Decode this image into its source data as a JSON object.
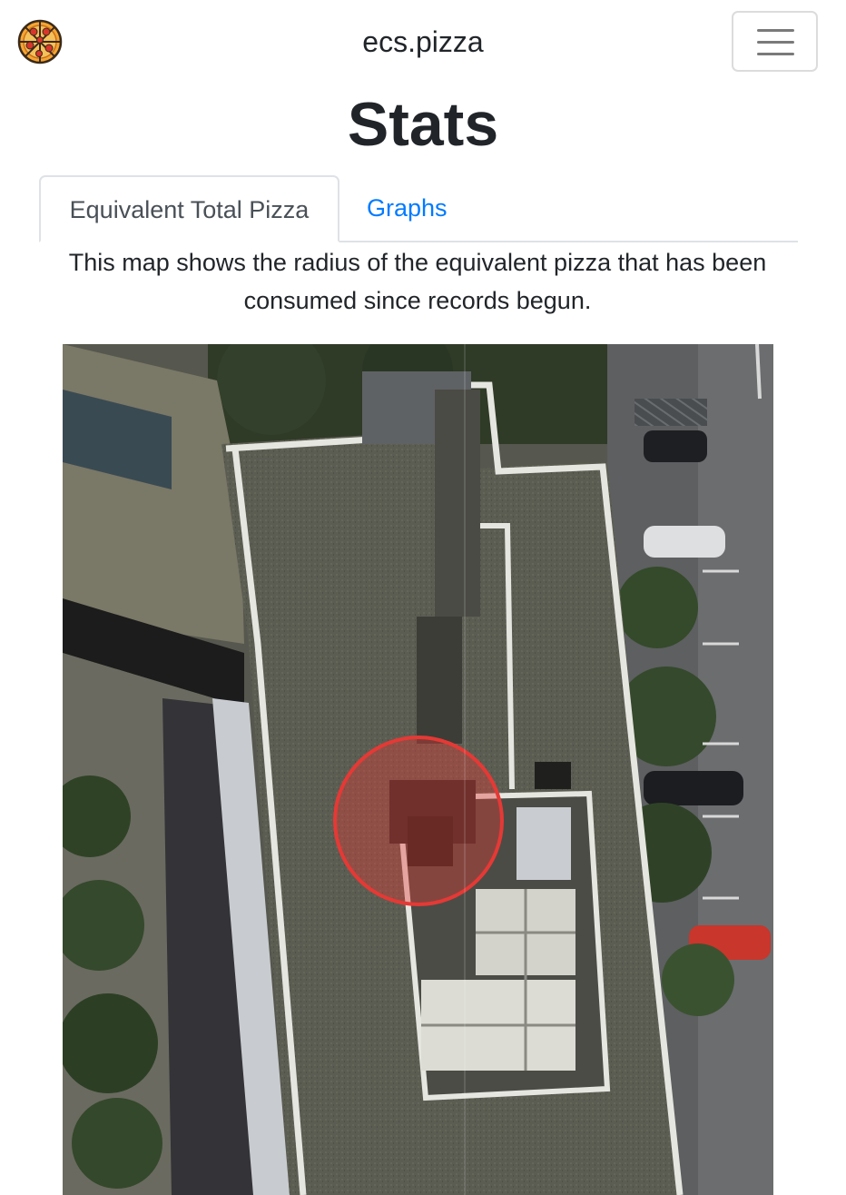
{
  "navbar": {
    "brand_icon": "pizza-icon",
    "brand": "ecs.pizza",
    "toggler_icon": "hamburger-menu-icon"
  },
  "page": {
    "title": "Stats"
  },
  "tabs": [
    {
      "label": "Equivalent Total Pizza",
      "active": true
    },
    {
      "label": "Graphs",
      "active": false
    }
  ],
  "description": "This map shows the radius of the equivalent pizza that has been consumed since records begun.",
  "map": {
    "type": "satellite",
    "overlay_color": "#e53935"
  }
}
